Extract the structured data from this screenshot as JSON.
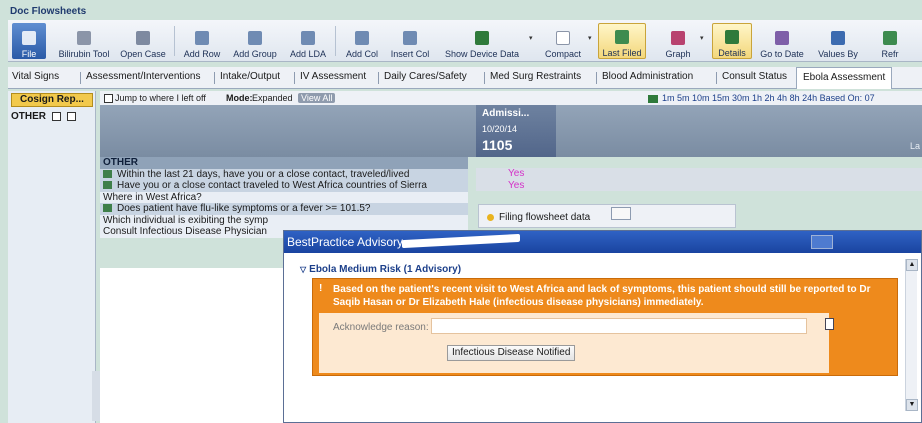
{
  "window": {
    "title": "Doc Flowsheets"
  },
  "toolbar": {
    "file": "File",
    "bilirubin": "Bilirubin Tool",
    "open_case": "Open Case",
    "add_row": "Add Row",
    "add_group": "Add Group",
    "add_lda": "Add LDA",
    "add_col": "Add Col",
    "insert_col": "Insert Col",
    "show_device": "Show Device Data",
    "compact": "Compact",
    "last_filed": "Last Filed",
    "graph": "Graph",
    "details": "Details",
    "go_to_date": "Go to Date",
    "values_by": "Values By",
    "refresh": "Refr"
  },
  "tabs": [
    "Vital Signs",
    "Assessment/Interventions",
    "Intake/Output",
    "IV Assessment",
    "Daily Cares/Safety",
    "Med Surg Restraints",
    "Blood Administration",
    "Consult Status",
    "Ebola Assessment"
  ],
  "left": {
    "cosign": "Cosign Rep...",
    "other": "OTHER"
  },
  "gridbar": {
    "jump": "Jump to where I left off",
    "mode_label": "Mode:",
    "mode_value": "Expanded",
    "view_all": "View All",
    "time_scale": "1m  5m  10m  15m  30m  1h  2h  4h  8h  24h  Based On: 07"
  },
  "header": {
    "adm": "Admissi...",
    "date": "10/20/14",
    "time": "1105",
    "la": "La"
  },
  "rows": {
    "section": "OTHER",
    "r1": "Within the last 21 days, have you or a close contact, traveled/lived",
    "r2": "Have you or a close contact traveled to West Africa countries of Sierra",
    "r3": "Where in West Africa?",
    "r4": "Does patient have flu-like symptoms or a fever >= 101.5?",
    "r5": "Which individual is exibiting the symp",
    "r6": "Consult Infectious Disease Physician"
  },
  "values": {
    "v1": "Yes",
    "v2": "Yes"
  },
  "filing": {
    "text": "Filing flowsheet data"
  },
  "bpa": {
    "title": "BestPractice Advisory",
    "risk": "Ebola Medium Risk (1 Advisory)",
    "warn_mark": "!",
    "message": "Based on the patient's recent visit to West Africa and lack of symptoms, this patient should still be reported to Dr Saqib Hasan or Dr Elizabeth Hale (infectious disease physicians) immediately.",
    "ack_label": "Acknowledge reason:",
    "notified_button": "Infectious Disease Notified"
  }
}
